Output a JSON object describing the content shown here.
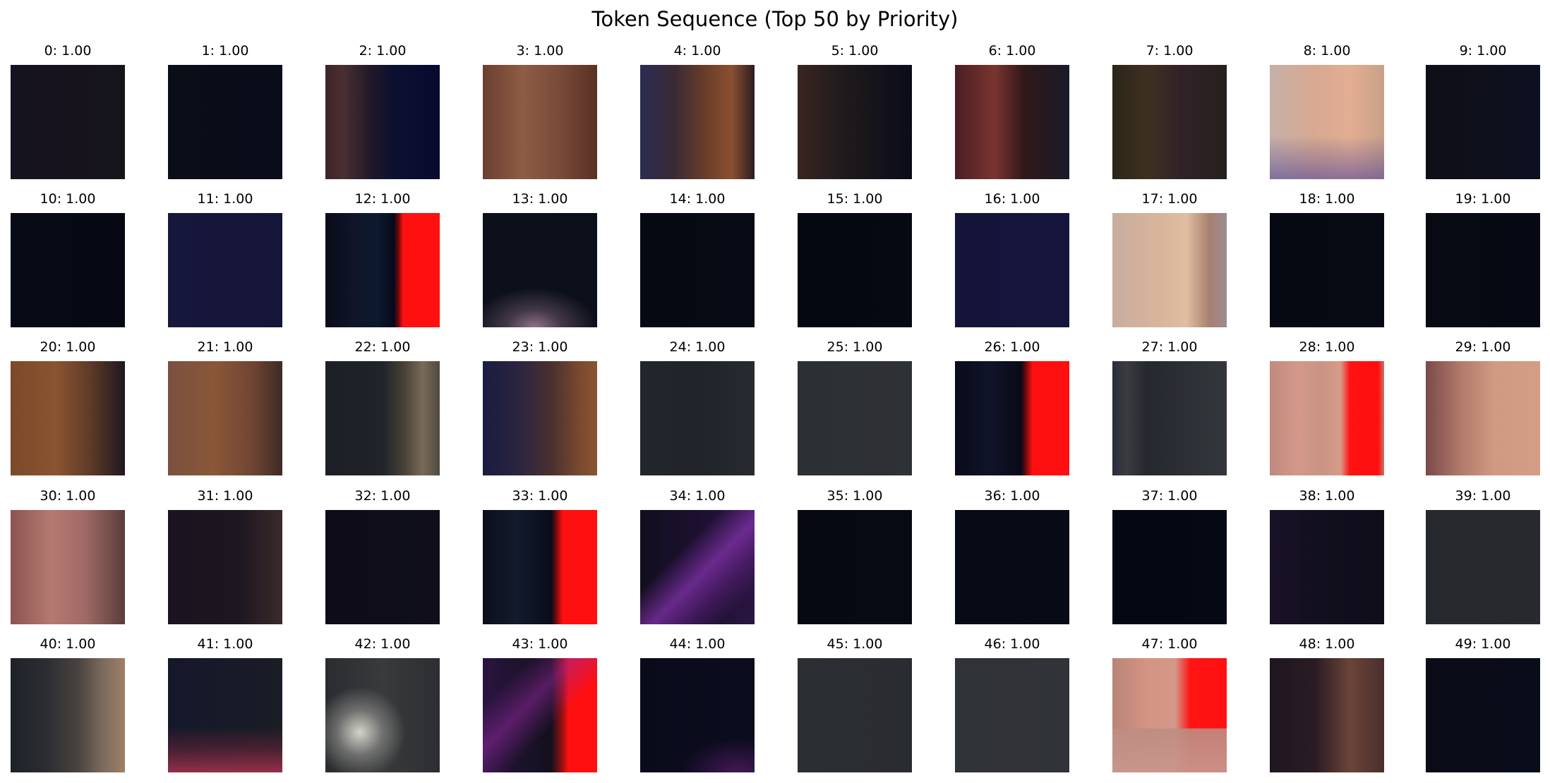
{
  "title": "Token Sequence (Top 50 by Priority)",
  "tiles": [
    {
      "label": "0: 1.00",
      "bg": "#16131d",
      "stops": [
        [
          "#161320",
          0
        ],
        [
          "#17131d",
          55
        ],
        [
          "#15141b",
          100
        ]
      ]
    },
    {
      "label": "1: 1.00",
      "bg": "#0a0c18",
      "stops": [
        [
          "#0b0d17",
          0
        ],
        [
          "#0a0c1a",
          100
        ]
      ]
    },
    {
      "label": "2: 1.00",
      "bg": "#1a1528",
      "stops": [
        [
          "#3d2328",
          0
        ],
        [
          "#4a2f30",
          15
        ],
        [
          "#20182a",
          40
        ],
        [
          "#0d1030",
          60
        ],
        [
          "#070a2e",
          100
        ]
      ]
    },
    {
      "label": "3: 1.00",
      "bg": "#7a4a38",
      "stops": [
        [
          "#6a3f30",
          0
        ],
        [
          "#8f5c44",
          35
        ],
        [
          "#7a4c3a",
          65
        ],
        [
          "#5a3024",
          100
        ]
      ]
    },
    {
      "label": "4: 1.00",
      "bg": "#3a2530",
      "stops": [
        [
          "#2a2c52",
          0
        ],
        [
          "#3a2a34",
          30
        ],
        [
          "#6e4028",
          60
        ],
        [
          "#8a5030",
          80
        ],
        [
          "#2b1c1f",
          100
        ]
      ]
    },
    {
      "label": "5: 1.00",
      "bg": "#14121c",
      "stops": [
        [
          "#3a2520",
          0
        ],
        [
          "#1f1a1c",
          40
        ],
        [
          "#0b0c1a",
          100
        ]
      ]
    },
    {
      "label": "6: 1.00",
      "bg": "#3a1e22",
      "stops": [
        [
          "#4a1e24",
          0
        ],
        [
          "#7a3430",
          35
        ],
        [
          "#301818",
          60
        ],
        [
          "#1a1a2a",
          100
        ]
      ]
    },
    {
      "label": "7: 1.00",
      "bg": "#2c2420",
      "stops": [
        [
          "#2a2418",
          0
        ],
        [
          "#3e3020",
          30
        ],
        [
          "#322228",
          60
        ],
        [
          "#26201c",
          100
        ]
      ]
    },
    {
      "label": "8: 1.00",
      "bg": "#c89a84",
      "stops": [
        [
          "#c6b0a8",
          0
        ],
        [
          "#d8a890",
          40
        ],
        [
          "#e3ae92",
          70
        ],
        [
          "#c8a088",
          100
        ]
      ],
      "overlay": "linear-gradient(to top, rgba(70,60,150,0.55) 0%, rgba(70,60,150,0) 38%)"
    },
    {
      "label": "9: 1.00",
      "bg": "#0d0f1a",
      "stops": [
        [
          "#0e0f16",
          0
        ],
        [
          "#0d1020",
          100
        ]
      ]
    },
    {
      "label": "10: 1.00",
      "bg": "#060914",
      "stops": [
        [
          "#070a14",
          0
        ],
        [
          "#060913",
          100
        ]
      ]
    },
    {
      "label": "11: 1.00",
      "bg": "#15163a",
      "stops": [
        [
          "#17173d",
          0
        ],
        [
          "#141538",
          100
        ]
      ]
    },
    {
      "label": "12: 1.00",
      "bg": "#0b0c1c",
      "stops": [
        [
          "#0a0b1a",
          0
        ],
        [
          "#10152a",
          25
        ],
        [
          "#0b1a2e",
          45
        ],
        [
          "#080a1a",
          60
        ],
        [
          "#6e0a0c",
          64
        ],
        [
          "#ff1010",
          68
        ],
        [
          "#ff0f0f",
          100
        ]
      ]
    },
    {
      "label": "13: 1.00",
      "bg": "#0a0f1a",
      "stops": [
        [
          "#0c101a",
          0
        ],
        [
          "#0a0f1a",
          100
        ]
      ],
      "overlay": "radial-gradient(ellipse 55% 35% at 45% 100%, rgba(150,120,140,0.95) 0%, rgba(100,80,100,0.6) 45%, rgba(10,15,26,0) 100%)"
    },
    {
      "label": "14: 1.00",
      "bg": "#060912",
      "stops": [
        [
          "#060912",
          0
        ],
        [
          "#070a14",
          100
        ]
      ]
    },
    {
      "label": "15: 1.00",
      "bg": "#050810",
      "stops": [
        [
          "#050810",
          0
        ],
        [
          "#060912",
          100
        ]
      ]
    },
    {
      "label": "16: 1.00",
      "bg": "#15143a",
      "stops": [
        [
          "#14143a",
          0
        ],
        [
          "#16153e",
          100
        ]
      ]
    },
    {
      "label": "17: 1.00",
      "bg": "#d4b49e",
      "stops": [
        [
          "#c8ae9e",
          0
        ],
        [
          "#d8b49c",
          40
        ],
        [
          "#e0bca0",
          65
        ],
        [
          "#a88070",
          85
        ],
        [
          "#9c8c94",
          100
        ]
      ]
    },
    {
      "label": "18: 1.00",
      "bg": "#060912",
      "stops": [
        [
          "#060912",
          0
        ],
        [
          "#070a13",
          100
        ]
      ]
    },
    {
      "label": "19: 1.00",
      "bg": "#060912",
      "stops": [
        [
          "#070a12",
          0
        ],
        [
          "#060913",
          100
        ]
      ]
    },
    {
      "label": "20: 1.00",
      "bg": "#6e4428",
      "stops": [
        [
          "#7a4a2a",
          0
        ],
        [
          "#8a5430",
          40
        ],
        [
          "#5e3a28",
          70
        ],
        [
          "#1e1820",
          100
        ]
      ]
    },
    {
      "label": "21: 1.00",
      "bg": "#744c38",
      "stops": [
        [
          "#7a5040",
          0
        ],
        [
          "#8a5838",
          40
        ],
        [
          "#6e4432",
          75
        ],
        [
          "#3e2a26",
          100
        ]
      ]
    },
    {
      "label": "22: 1.00",
      "bg": "#1e2226",
      "stops": [
        [
          "#1c2026",
          0
        ],
        [
          "#20232a",
          50
        ],
        [
          "#4a4438",
          70
        ],
        [
          "#7a6a58",
          85
        ],
        [
          "#4e4a40",
          100
        ]
      ]
    },
    {
      "label": "23: 1.00",
      "bg": "#2c2234",
      "stops": [
        [
          "#1a1c40",
          0
        ],
        [
          "#2a2440",
          30
        ],
        [
          "#4a3030",
          60
        ],
        [
          "#7a4a30",
          85
        ],
        [
          "#8a5430",
          100
        ]
      ]
    },
    {
      "label": "24: 1.00",
      "bg": "#22252a",
      "stops": [
        [
          "#23272c",
          0
        ],
        [
          "#20242a",
          50
        ],
        [
          "#272b30",
          100
        ]
      ]
    },
    {
      "label": "25: 1.00",
      "bg": "#2c2f34",
      "stops": [
        [
          "#2c2f34",
          0
        ],
        [
          "#2e3136",
          100
        ]
      ]
    },
    {
      "label": "26: 1.00",
      "bg": "#0b0c1c",
      "stops": [
        [
          "#0a0b1a",
          0
        ],
        [
          "#10142a",
          30
        ],
        [
          "#0a0a18",
          58
        ],
        [
          "#6e0a0c",
          62
        ],
        [
          "#ff1010",
          68
        ],
        [
          "#ff0f0f",
          100
        ]
      ]
    },
    {
      "label": "27: 1.00",
      "bg": "#30333a",
      "stops": [
        [
          "#2a2c40",
          0
        ],
        [
          "#3a3c40",
          12
        ],
        [
          "#25282e",
          30
        ],
        [
          "#34373c",
          100
        ]
      ]
    },
    {
      "label": "28: 1.00",
      "bg": "#c08878",
      "stops": [
        [
          "#c08a80",
          0
        ],
        [
          "#d49888",
          25
        ],
        [
          "#c89484",
          45
        ],
        [
          "#d89a88",
          62
        ],
        [
          "#ff1212",
          70
        ],
        [
          "#ff0f0f",
          95
        ],
        [
          "#c07868",
          100
        ]
      ]
    },
    {
      "label": "29: 1.00",
      "bg": "#c89078",
      "stops": [
        [
          "#7a4a4a",
          0
        ],
        [
          "#b07a6a",
          30
        ],
        [
          "#d09a82",
          60
        ],
        [
          "#d49c84",
          100
        ]
      ]
    },
    {
      "label": "30: 1.00",
      "bg": "#a86e66",
      "stops": [
        [
          "#8a5450",
          0
        ],
        [
          "#b47a70",
          35
        ],
        [
          "#a06a66",
          65
        ],
        [
          "#5a3c3c",
          100
        ]
      ]
    },
    {
      "label": "31: 1.00",
      "bg": "#1a1420",
      "stops": [
        [
          "#1a1420",
          0
        ],
        [
          "#1c1620",
          60
        ],
        [
          "#3a2a2a",
          100
        ]
      ]
    },
    {
      "label": "32: 1.00",
      "bg": "#0d0c18",
      "stops": [
        [
          "#0d0c18",
          0
        ],
        [
          "#0f0e1a",
          100
        ]
      ]
    },
    {
      "label": "33: 1.00",
      "bg": "#0b0c1c",
      "stops": [
        [
          "#0d0e1c",
          0
        ],
        [
          "#121a2c",
          30
        ],
        [
          "#0a0c1a",
          60
        ],
        [
          "#6e0a0c",
          64
        ],
        [
          "#ff1010",
          70
        ],
        [
          "#ff0f0f",
          100
        ]
      ]
    },
    {
      "label": "34: 1.00",
      "bg": "#141020",
      "stops": [
        [
          "#120e1e",
          0
        ],
        [
          "#1c1030",
          50
        ],
        [
          "#2a1540",
          100
        ]
      ],
      "overlay": "linear-gradient(135deg, rgba(0,0,0,0) 35%, rgba(130,50,170,0.75) 55%, rgba(90,30,120,0.6) 70%, rgba(0,0,0,0) 85%)"
    },
    {
      "label": "35: 1.00",
      "bg": "#060912",
      "stops": [
        [
          "#060912",
          0
        ],
        [
          "#070a13",
          100
        ]
      ]
    },
    {
      "label": "36: 1.00",
      "bg": "#050a14",
      "stops": [
        [
          "#050a14",
          0
        ],
        [
          "#060b15",
          100
        ]
      ]
    },
    {
      "label": "37: 1.00",
      "bg": "#040812",
      "stops": [
        [
          "#040812",
          0
        ],
        [
          "#050913",
          100
        ]
      ]
    },
    {
      "label": "38: 1.00",
      "bg": "#120f1e",
      "stops": [
        [
          "#1a1228",
          0
        ],
        [
          "#120f1e",
          40
        ],
        [
          "#0f0d1a",
          100
        ]
      ]
    },
    {
      "label": "39: 1.00",
      "bg": "#25282c",
      "stops": [
        [
          "#25282c",
          0
        ],
        [
          "#27292e",
          100
        ]
      ]
    },
    {
      "label": "40: 1.00",
      "bg": "#24282c",
      "stops": [
        [
          "#1e2228",
          0
        ],
        [
          "#2a2c30",
          30
        ],
        [
          "#4a4440",
          60
        ],
        [
          "#7a6a5c",
          80
        ],
        [
          "#a08068",
          100
        ]
      ]
    },
    {
      "label": "41: 1.00",
      "bg": "#161a24",
      "stops": [
        [
          "#14182a",
          0
        ],
        [
          "#1a1c26",
          100
        ]
      ],
      "overlay": "linear-gradient(to top, rgba(170,50,80,0.85) 0%, rgba(120,40,60,0.5) 20%, rgba(0,0,0,0) 40%)"
    },
    {
      "label": "42: 1.00",
      "bg": "#2e3034",
      "stops": [
        [
          "#2a2c30",
          0
        ],
        [
          "#383a3c",
          50
        ],
        [
          "#2c2e32",
          100
        ]
      ],
      "overlay": "radial-gradient(ellipse 40% 40% at 30% 65%, rgba(220,220,210,0.95) 0%, rgba(150,150,145,0.6) 50%, rgba(0,0,0,0) 100%)"
    },
    {
      "label": "43: 1.00",
      "bg": "#1a1028",
      "stops": [
        [
          "#2a1440",
          0
        ],
        [
          "#1a1228",
          40
        ],
        [
          "#14101e",
          60
        ],
        [
          "#a01010",
          70
        ],
        [
          "#ff1010",
          75
        ],
        [
          "#ff0f0f",
          100
        ]
      ],
      "overlay": "linear-gradient(135deg, rgba(0,0,0,0) 20%, rgba(150,40,160,0.5) 40%, rgba(0,0,0,0) 60%)"
    },
    {
      "label": "44: 1.00",
      "bg": "#0a0b1c",
      "stops": [
        [
          "#0a0b1a",
          0
        ],
        [
          "#0b0c1e",
          100
        ]
      ],
      "overlay": "radial-gradient(ellipse 50% 30% at 85% 100%, rgba(90,30,110,0.7) 0%, rgba(0,0,0,0) 100%)"
    },
    {
      "label": "45: 1.00",
      "bg": "#2a2d32",
      "stops": [
        [
          "#2b2e33",
          0
        ],
        [
          "#292c31",
          100
        ]
      ]
    },
    {
      "label": "46: 1.00",
      "bg": "#2f3237",
      "stops": [
        [
          "#2f3237",
          0
        ],
        [
          "#303338",
          100
        ]
      ]
    },
    {
      "label": "47: 1.00",
      "bg": "#c88878",
      "stops": [
        [
          "#b88478",
          0
        ],
        [
          "#d49484",
          30
        ],
        [
          "#d29888",
          55
        ],
        [
          "#ff1414",
          68
        ],
        [
          "#ff1010",
          100
        ]
      ],
      "overlay": "linear-gradient(to top, rgba(200,150,140,0.95) 0%, rgba(190,140,130,0.9) 38%, rgba(0,0,0,0) 39%)"
    },
    {
      "label": "48: 1.00",
      "bg": "#241820",
      "stops": [
        [
          "#1e1620",
          0
        ],
        [
          "#2a1c24",
          40
        ],
        [
          "#6a4438",
          70
        ],
        [
          "#4a2e2c",
          100
        ]
      ]
    },
    {
      "label": "49: 1.00",
      "bg": "#090c18",
      "stops": [
        [
          "#0a0c18",
          0
        ],
        [
          "#090c19",
          100
        ]
      ]
    }
  ]
}
